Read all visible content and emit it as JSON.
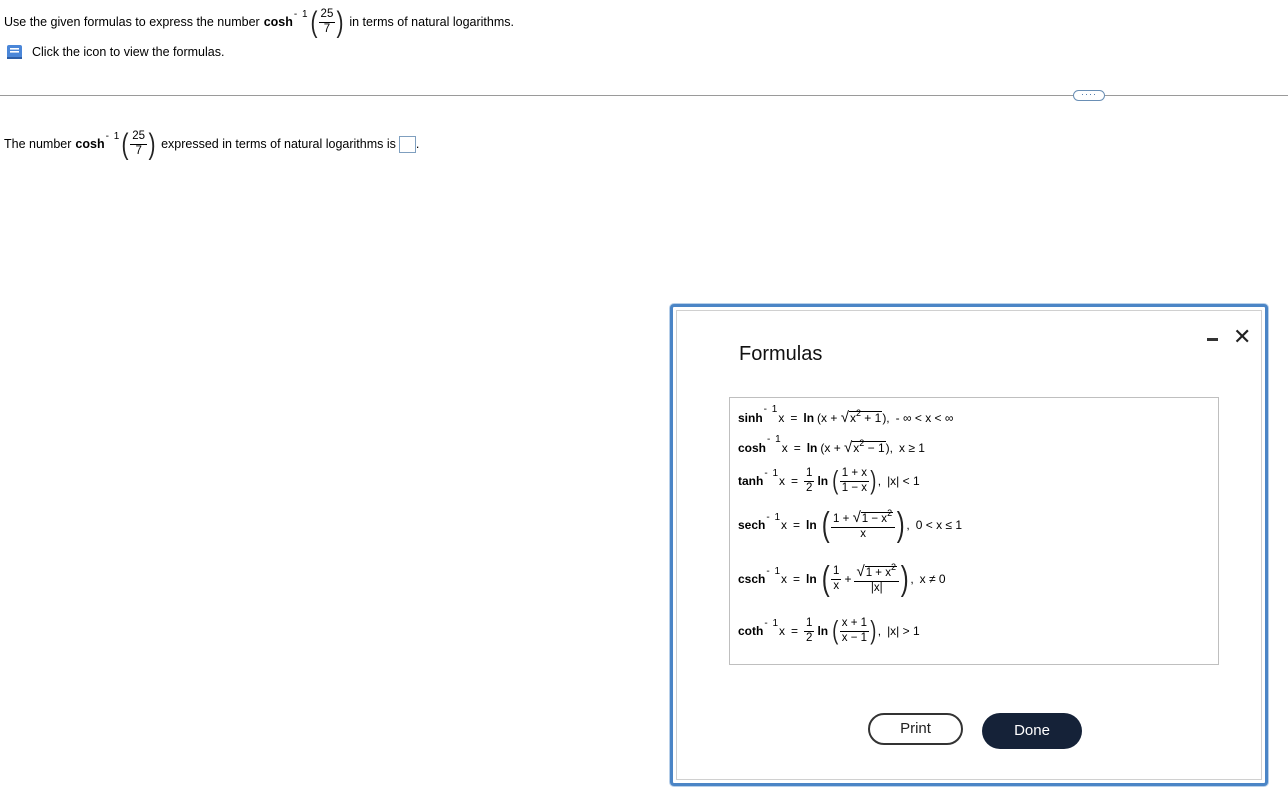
{
  "question": {
    "prefix": "Use the given formulas to express the number",
    "func": "cosh",
    "exponent": "- 1",
    "numerator": "25",
    "denominator": "7",
    "suffix": "in terms of natural logarithms."
  },
  "formulas_link": {
    "text": "Click the icon to view the formulas.",
    "icon": "book-icon"
  },
  "more_button": {
    "label": "····"
  },
  "answer": {
    "prefix": "The number",
    "func": "cosh",
    "exponent": "- 1",
    "numerator": "25",
    "denominator": "7",
    "suffix": "expressed in terms of natural logarithms is",
    "value": "",
    "period": "."
  },
  "dialog": {
    "title": "Formulas",
    "minimize_icon": "minimize-icon",
    "close_icon": "close-icon",
    "formulas": [
      {
        "fn": "sinh",
        "exp": "- 1",
        "var": "x",
        "expr": "ln(x + √(x² + 1))",
        "condition": "- ∞ < x < ∞"
      },
      {
        "fn": "cosh",
        "exp": "- 1",
        "var": "x",
        "expr": "ln(x + √(x² - 1))",
        "condition": "x ≥ 1"
      },
      {
        "fn": "tanh",
        "exp": "- 1",
        "var": "x",
        "expr": "(1/2) ln((1 + x)/(1 - x))",
        "condition": "|x| < 1"
      },
      {
        "fn": "sech",
        "exp": "- 1",
        "var": "x",
        "expr": "ln((1 + √(1 - x²))/x)",
        "condition": "0 < x ≤ 1"
      },
      {
        "fn": "csch",
        "exp": "- 1",
        "var": "x",
        "expr": "ln(1/x + √(1 + x²)/|x|)",
        "condition": "x ≠ 0"
      },
      {
        "fn": "coth",
        "exp": "- 1",
        "var": "x",
        "expr": "(1/2) ln((x + 1)/(x - 1))",
        "condition": "|x| > 1"
      }
    ],
    "print_label": "Print",
    "done_label": "Done"
  }
}
